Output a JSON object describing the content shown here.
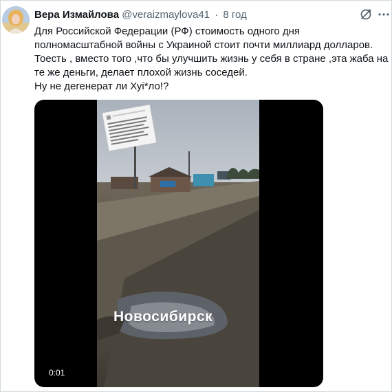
{
  "tweet": {
    "display_name": "Вера Измайлова",
    "handle": "@veraizmaylova41",
    "separator": "·",
    "time": "8 год",
    "text_lines": [
      "Для Российской Федерации (РФ) стоимость одного дня",
      "полномасштабной войны с Украиной стоит почти миллиард долларов.",
      "Тоесть , вместо того ,что бы улучшить жизнь у себя в стране ,эта жаба на",
      "те же деньги, делает плохой жизнь соседей.",
      "Ну не дегенерат ли Хуі*ло!?"
    ]
  },
  "media": {
    "city_caption": "Новосибирск",
    "timestamp": "0:01"
  },
  "icons": {
    "edit": "edit-slash-icon",
    "more": "more-options-icon",
    "avatar": "user-avatar"
  },
  "colors": {
    "text": "#0f1419",
    "secondary": "#536471",
    "border": "#cfd9de",
    "media_bg": "#000000"
  }
}
